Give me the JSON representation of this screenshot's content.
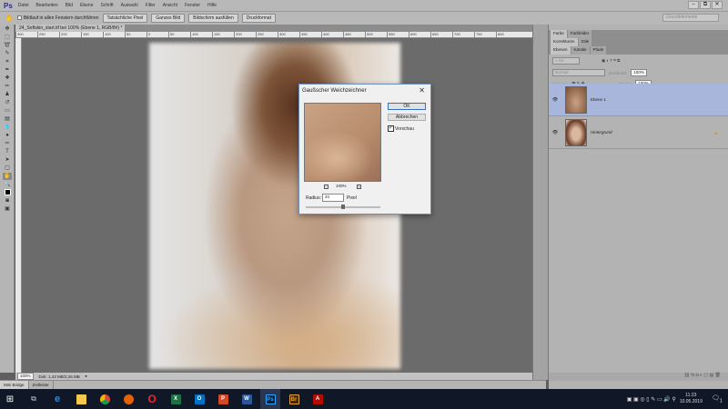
{
  "app": {
    "logo": "Ps"
  },
  "menu": [
    "Datei",
    "Bearbeiten",
    "Bild",
    "Ebene",
    "Schrift",
    "Auswahl",
    "Filter",
    "Ansicht",
    "Fenster",
    "Hilfe"
  ],
  "window_controls": {
    "minimize": "–",
    "restore": "⧉",
    "close": "✕"
  },
  "options": {
    "scroll_all": "Bildlauf in allen Fenstern durchführen",
    "buttons": [
      "Tatsächliche Pixel",
      "Ganzes Bild",
      "Bildschirm ausfüllen",
      "Druckformat"
    ],
    "workspace": "Grundelemente"
  },
  "document": {
    "tab_title": "24_Softskin_start.tif bei 100% (Ebene 1, RGB/8#) *",
    "ruler": [
      "300",
      "250",
      "200",
      "150",
      "100",
      "50",
      "0",
      "50",
      "100",
      "150",
      "200",
      "250",
      "300",
      "350",
      "400",
      "450",
      "500",
      "550",
      "600",
      "650",
      "700",
      "750",
      "800"
    ]
  },
  "status": {
    "zoom": "100%",
    "doc": "Dok: 1,43 MB/3,26 MB"
  },
  "bottom_tabs": [
    "Mini Bridge",
    "Zeitleiste"
  ],
  "panels": {
    "group1": [
      "Farbe",
      "Farbfelder"
    ],
    "group2": [
      "Korrekturen",
      "Stile"
    ],
    "group3": [
      "Ebenen",
      "Kanäle",
      "Pfade"
    ],
    "filter_kind": "Art",
    "blend_mode": "Normal",
    "opacity_label": "Deckkraft:",
    "opacity": "100%",
    "lock_label": "Fixieren:",
    "fill_label": "Fläche:",
    "fill": "100%",
    "layers": [
      {
        "name": "Ebene 1",
        "selected": true
      },
      {
        "name": "Hintergrund",
        "selected": false
      }
    ]
  },
  "dialog": {
    "title": "Gaußscher Weichzeichner",
    "ok": "OK",
    "cancel": "Abbrechen",
    "preview_label": "Vorschau",
    "preview_checked": true,
    "zoom": "100%",
    "radius_label": "Radius:",
    "radius": "40",
    "unit": "Pixel",
    "slider_fraction": 0.5
  },
  "taskbar": {
    "time": "11:23",
    "date": "10.05.2019",
    "notifications": "1"
  }
}
